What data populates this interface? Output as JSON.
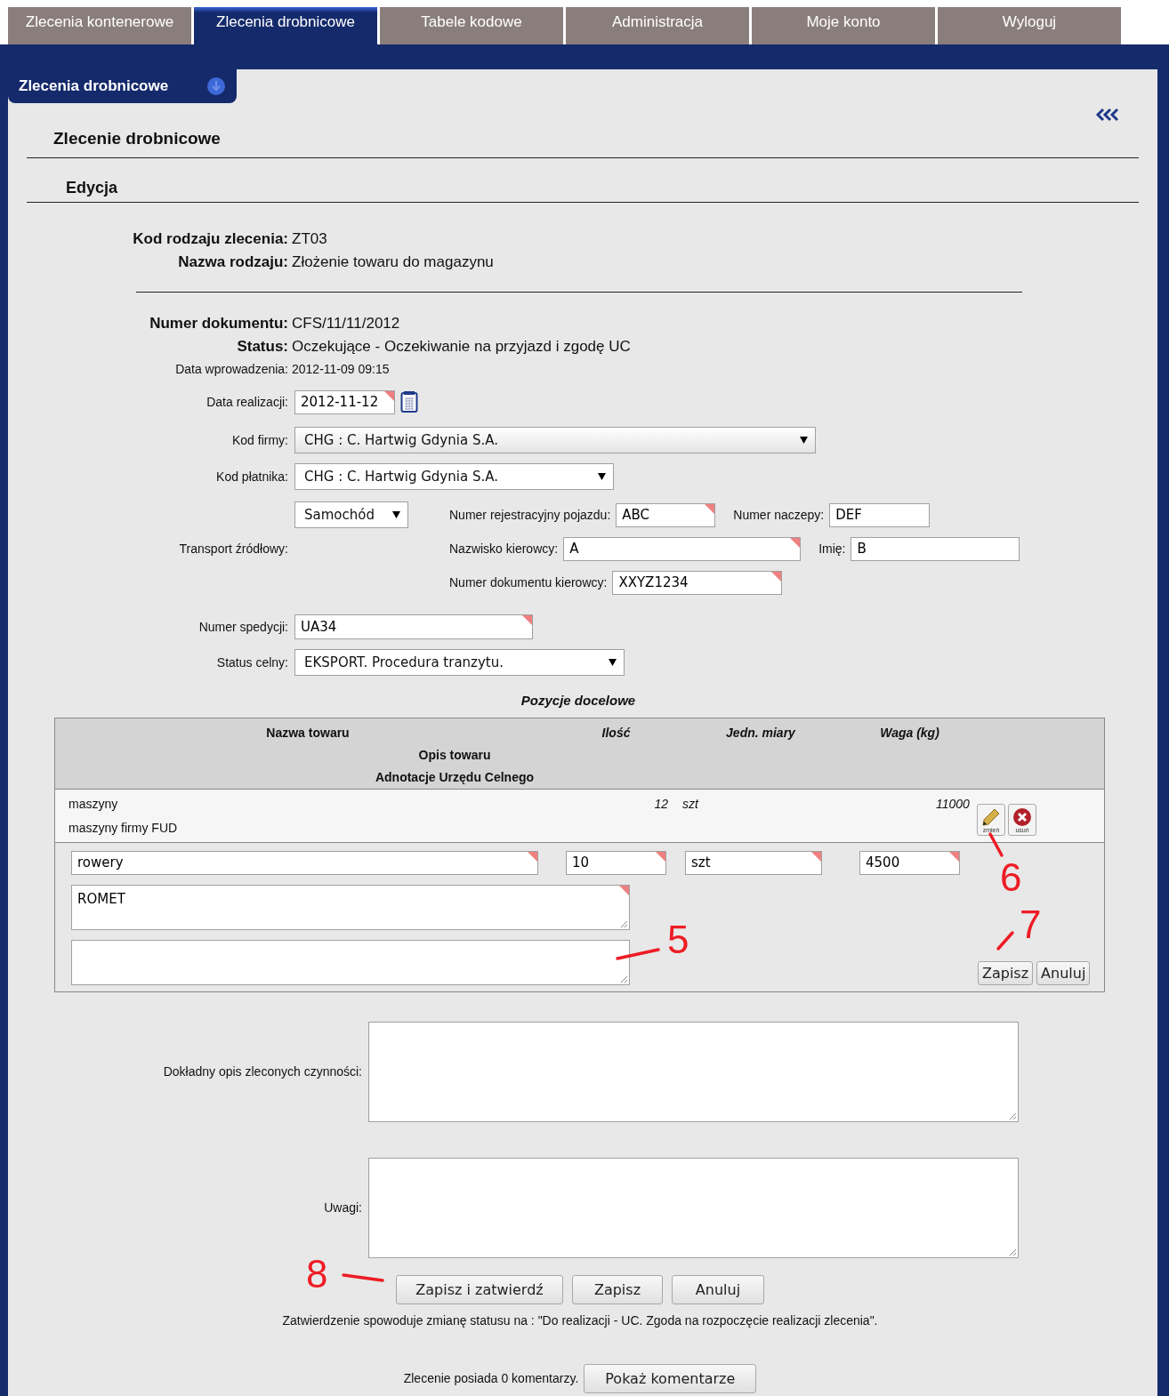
{
  "tabs": [
    {
      "label": "Zlecenia kontenerowe",
      "selected": false
    },
    {
      "label": "Zlecenia drobnicowe",
      "selected": true
    },
    {
      "label": "Tabele kodowe",
      "selected": false
    },
    {
      "label": "Administracja",
      "selected": false
    },
    {
      "label": "Moje konto",
      "selected": false
    },
    {
      "label": "Wyloguj",
      "selected": false
    }
  ],
  "section_tab": {
    "label": "Zlecenia drobnicowe"
  },
  "page_title": "Zlecenie drobnicowe",
  "subtitle": "Edycja",
  "type_info": [
    {
      "label": "Kod rodzaju zlecenia:",
      "value": "ZT03"
    },
    {
      "label": "Nazwa rodzaju:",
      "value": "Złożenie towaru do magazynu"
    }
  ],
  "doc_info": [
    {
      "label": "Numer dokumentu:",
      "value": "CFS/11/11/2012"
    },
    {
      "label": "Status:",
      "value": "Oczekujące - Oczekiwanie na przyjazd i zgodę UC"
    }
  ],
  "entry_date": {
    "label": "Data wprowadzenia:",
    "value": "2012-11-09 09:15"
  },
  "realization_date": {
    "label": "Data realizacji:",
    "value": "2012-11-12",
    "required": true
  },
  "company_code": {
    "label": "Kod firmy:",
    "value": "CHG : C. Hartwig Gdynia S.A."
  },
  "payer_code": {
    "label": "Kod płatnika:",
    "value": "CHG : C. Hartwig Gdynia S.A."
  },
  "transport": {
    "label": "Transport źródłowy:",
    "mode": "Samochód",
    "rows": [
      [
        {
          "label": "Numer rejestracyjny pojazdu:",
          "value": "ABC",
          "required": true
        },
        {
          "label": "Numer naczepy:",
          "value": "DEF",
          "required": false
        }
      ],
      [
        {
          "label": "Nazwisko kierowcy:",
          "value": "A",
          "required": true
        },
        {
          "label": "Imię:",
          "value": "B",
          "required": false
        }
      ],
      [
        {
          "label": "Numer dokumentu kierowcy:",
          "value": "XXYZ1234",
          "required": true
        }
      ]
    ]
  },
  "forwarding_number": {
    "label": "Numer spedycji:",
    "value": "UA34",
    "required": true
  },
  "customs_status": {
    "label": "Status celny:",
    "value": "EKSPORT. Procedura tranzytu."
  },
  "positions": {
    "title": "Pozycje docelowe",
    "columns": [
      "Nazwa towaru",
      "Ilość",
      "Jedn. miary",
      "Waga (kg)"
    ],
    "subheaders": [
      "Opis towaru",
      "Adnotacje Urzędu Celnego"
    ],
    "rows": [
      {
        "name": "maszyny",
        "quantity": "12",
        "unit": "szt",
        "weight": "11000",
        "description": "maszyny firmy FUD",
        "edit_label": "zmień",
        "delete_label": "usuń"
      }
    ],
    "edit_row": {
      "name": {
        "value": "rowery",
        "required": true
      },
      "quantity": {
        "value": "10",
        "required": true
      },
      "unit": {
        "value": "szt",
        "required": true
      },
      "weight": {
        "value": "4500",
        "required": true
      },
      "description": {
        "value": "ROMET",
        "required": true
      },
      "buttons": [
        "Zapisz",
        "Anuluj"
      ]
    }
  },
  "details": {
    "label": "Dokładny opis zleconych czynności:"
  },
  "remarks": {
    "label": "Uwagi:"
  },
  "actions": [
    "Zapisz i zatwierdź",
    "Zapisz",
    "Anuluj"
  ],
  "approval_note": "Zatwierdzenie spowoduje zmianę statusu na : \"Do realizacji - UC. Zgoda na rozpoczęcie realizacji zlecenia\".",
  "comments": {
    "text": "Zlecenie posiada 0 komentarzy.",
    "button": "Pokaż komentarze"
  },
  "annotations": [
    {
      "label": "5"
    },
    {
      "label": "6"
    },
    {
      "label": "7"
    },
    {
      "label": "8"
    }
  ]
}
